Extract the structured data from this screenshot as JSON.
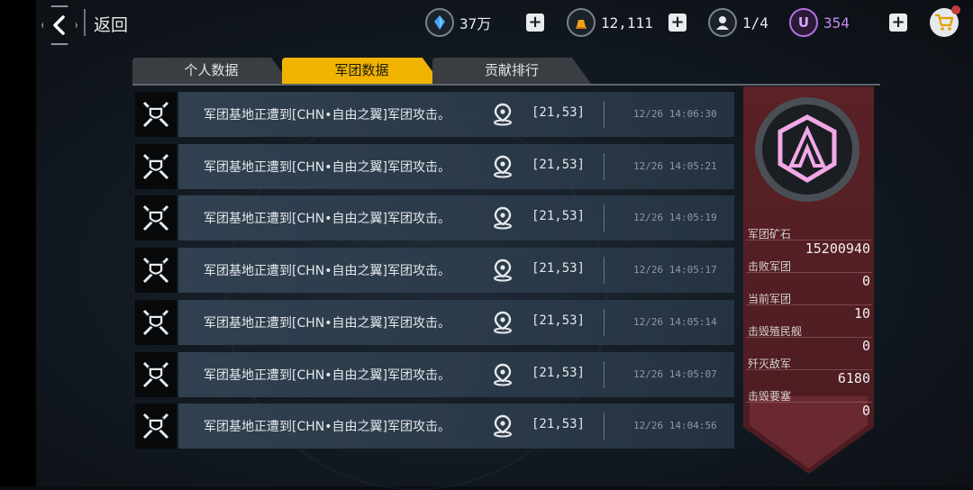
{
  "header": {
    "back_label": "返回",
    "resources": [
      {
        "icon": "crystal-icon",
        "value": "37万",
        "color": "#3ea6ff"
      },
      {
        "icon": "gold-bar-icon",
        "value": "12,111",
        "color": "#f0a21a"
      },
      {
        "icon": "pilot-icon",
        "value": "1/4",
        "color": "#e6e9ec"
      },
      {
        "icon": "u-coin-icon",
        "value": "354",
        "color": "#b46fe0"
      }
    ]
  },
  "tabs": [
    {
      "label": "个人数据",
      "active": false
    },
    {
      "label": "军团数据",
      "active": true
    },
    {
      "label": "贡献排行",
      "active": false
    }
  ],
  "records": [
    {
      "message": "军团基地正遭到[CHN•自由之翼]军团攻击。",
      "coord": "[21,53]",
      "time": "12/26 14:06:30"
    },
    {
      "message": "军团基地正遭到[CHN•自由之翼]军团攻击。",
      "coord": "[21,53]",
      "time": "12/26 14:05:21"
    },
    {
      "message": "军团基地正遭到[CHN•自由之翼]军团攻击。",
      "coord": "[21,53]",
      "time": "12/26 14:05:19"
    },
    {
      "message": "军团基地正遭到[CHN•自由之翼]军团攻击。",
      "coord": "[21,53]",
      "time": "12/26 14:05:17"
    },
    {
      "message": "军团基地正遭到[CHN•自由之翼]军团攻击。",
      "coord": "[21,53]",
      "time": "12/26 14:05:14"
    },
    {
      "message": "军团基地正遭到[CHN•自由之翼]军团攻击。",
      "coord": "[21,53]",
      "time": "12/26 14:05:07"
    },
    {
      "message": "军团基地正遭到[CHN•自由之翼]军团攻击。",
      "coord": "[21,53]",
      "time": "12/26 14:04:56"
    }
  ],
  "stats": [
    {
      "label": "军团矿石",
      "value": "15200940"
    },
    {
      "label": "击败军团",
      "value": "0"
    },
    {
      "label": "当前军团",
      "value": "10"
    },
    {
      "label": "击毁殖民舰",
      "value": "0"
    },
    {
      "label": "歼灭敌军",
      "value": "6180"
    },
    {
      "label": "击毁要塞",
      "value": "0"
    }
  ],
  "colors": {
    "active_tab": "#f0b400",
    "banner": "#4b1c21",
    "emblem": "#f2a8e6"
  }
}
